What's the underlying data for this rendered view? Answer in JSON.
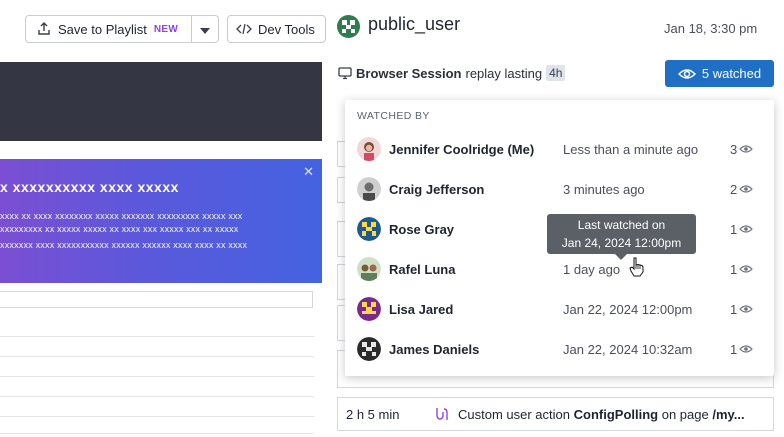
{
  "toolbar": {
    "playlist_label": "Save to Playlist",
    "new_badge": "NEW",
    "dev_tools_label": "Dev Tools"
  },
  "banner": {
    "title": "x xxxxxxxxxx xxxx xxxxx",
    "lines": [
      "xxxx xx xxxx xxxxxxxx xxxxx xxxxxxx xxxxxxxxx xxxxx xxx",
      "xxxxxxxxx xx xxxxx xxxxx xx xxxx xxx xxxxx xxx xx xxxxx",
      "xxxxxxx xxxx xxxxxxxxxxx xxxxxx xxxxxx xxxx xxxx xx xxxx"
    ]
  },
  "header": {
    "username": "public_user",
    "date": "Jan 18, 3:30 pm"
  },
  "session": {
    "label": "Browser Session",
    "mid_text": "replay lasting",
    "duration": "4h",
    "watched_label": "5 watched"
  },
  "watchers": {
    "header": "WATCHED BY",
    "rows": [
      {
        "name": "Jennifer Coolridge (Me)",
        "time": "Less than a minute ago",
        "count": "3"
      },
      {
        "name": "Craig Jefferson",
        "time": "3 minutes ago",
        "count": "2"
      },
      {
        "name": "Rose Gray",
        "time": "",
        "count": "1"
      },
      {
        "name": "Rafel Luna",
        "time": "1 day ago",
        "count": "1"
      },
      {
        "name": "Lisa Jared",
        "time": "Jan 22, 2024 12:00pm",
        "count": "1"
      },
      {
        "name": "James Daniels",
        "time": "Jan 22, 2024 10:32am",
        "count": "1"
      }
    ]
  },
  "tooltip": {
    "line1": "Last watched on",
    "line2": "Jan 24, 2024 12:00pm"
  },
  "event": {
    "duration": "2 h 5 min",
    "prefix": "Custom user action",
    "action": "ConfigPolling",
    "mid": "on page",
    "page": "/my..."
  },
  "colors": {
    "primary": "#1f6fc5",
    "new_badge": "#8e44ec",
    "dark_band": "#343644",
    "banner_start": "#7b4fd3",
    "banner_end": "#4463e0"
  }
}
